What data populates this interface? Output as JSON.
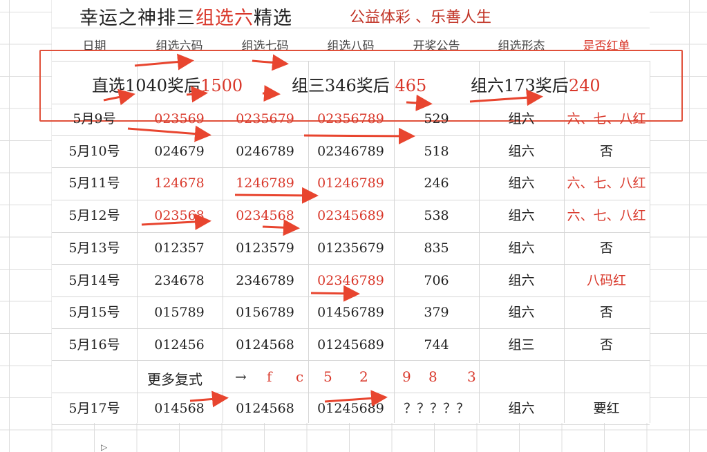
{
  "title": {
    "part1": "幸运之神排三",
    "part2": "组选六",
    "part3": "精选"
  },
  "slogan": "公益体彩 、乐善人生",
  "headers": [
    "日期",
    "组选六码",
    "组选七码",
    "组选八码",
    "开奖公告",
    "组选形态",
    "是否红单"
  ],
  "banner": {
    "direct_label": "直选1040奖后",
    "direct_value": "1500",
    "group3_label": "组三346奖后",
    "group3_value": "465",
    "group6_label": "组六173奖后",
    "group6_value": "240"
  },
  "rows": [
    {
      "date": "5月9号",
      "six": "023569",
      "seven": "0235679",
      "eight": "02356789",
      "draw": "529",
      "form": "组六",
      "red": "六、七、八红",
      "red_cols": [
        1,
        2,
        3,
        6
      ]
    },
    {
      "date": "5月10号",
      "six": "024679",
      "seven": "0246789",
      "eight": "02346789",
      "draw": "518",
      "form": "组六",
      "red": "否",
      "red_cols": []
    },
    {
      "date": "5月11号",
      "six": "124678",
      "seven": "1246789",
      "eight": "01246789",
      "draw": "246",
      "form": "组六",
      "red": "六、七、八红",
      "red_cols": [
        1,
        2,
        3,
        6
      ]
    },
    {
      "date": "5月12号",
      "six": "023568",
      "seven": "0234568",
      "eight": "02345689",
      "draw": "538",
      "form": "组六",
      "red": "六、七、八红",
      "red_cols": [
        1,
        2,
        3,
        6
      ]
    },
    {
      "date": "5月13号",
      "six": "012357",
      "seven": "0123579",
      "eight": "01235679",
      "draw": "835",
      "form": "组六",
      "red": "否",
      "red_cols": []
    },
    {
      "date": "5月14号",
      "six": "234678",
      "seven": "2346789",
      "eight": "02346789",
      "draw": "706",
      "form": "组六",
      "red": "八码红",
      "red_cols": [
        3,
        6
      ]
    },
    {
      "date": "5月15号",
      "six": "015789",
      "seven": "0156789",
      "eight": "01456789",
      "draw": "379",
      "form": "组六",
      "red": "否",
      "red_cols": []
    },
    {
      "date": "5月16号",
      "six": "012456",
      "seven": "0124568",
      "eight": "01245689",
      "draw": "744",
      "form": "组三",
      "red": "否",
      "red_cols": []
    }
  ],
  "more": {
    "label": "更多复式",
    "arrow": "→",
    "code": [
      "f",
      "c",
      "5",
      "2",
      "9",
      "8",
      "3"
    ]
  },
  "next_row": {
    "date": "5月17号",
    "six": "014568",
    "seven": "0124568",
    "eight": "01245689",
    "draw": "？？？？？",
    "form": "组六",
    "red": "要红"
  },
  "colors": {
    "accent_red": "#d9382b",
    "box_red": "#e0503a"
  }
}
